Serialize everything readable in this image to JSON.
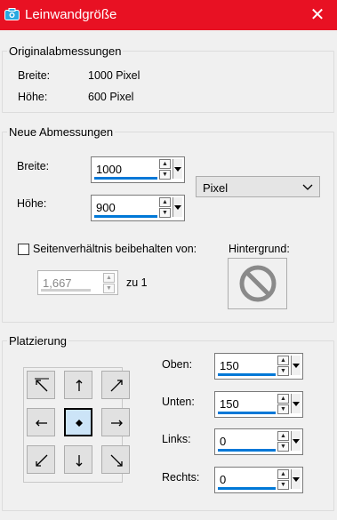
{
  "window": {
    "title": "Leinwandgröße",
    "close_glyph": "✕"
  },
  "original": {
    "legend": "Originalabmessungen",
    "width_label": "Breite:",
    "width_value": "1000 Pixel",
    "height_label": "Höhe:",
    "height_value": "600 Pixel"
  },
  "new_dims": {
    "legend": "Neue Abmessungen",
    "width_label": "Breite:",
    "width_value": "1000",
    "height_label": "Höhe:",
    "height_value": "900",
    "unit_selected": "Pixel",
    "keep_ratio_label": "Seitenverhältnis beibehalten von:",
    "keep_ratio_checked": false,
    "ratio_value": "1,667",
    "ratio_suffix": "zu 1",
    "background_label": "Hintergrund:"
  },
  "placement": {
    "legend": "Platzierung",
    "anchors": [
      "top-left",
      "top",
      "top-right",
      "left",
      "center",
      "right",
      "bottom-left",
      "bottom",
      "bottom-right"
    ],
    "selected_anchor": "center",
    "top_label": "Oben:",
    "top_value": "150",
    "bottom_label": "Unten:",
    "bottom_value": "150",
    "left_label": "Links:",
    "left_value": "0",
    "right_label": "Rechts:",
    "right_value": "0"
  },
  "colors": {
    "title_bar": "#e81123",
    "accent": "#0078d7"
  }
}
